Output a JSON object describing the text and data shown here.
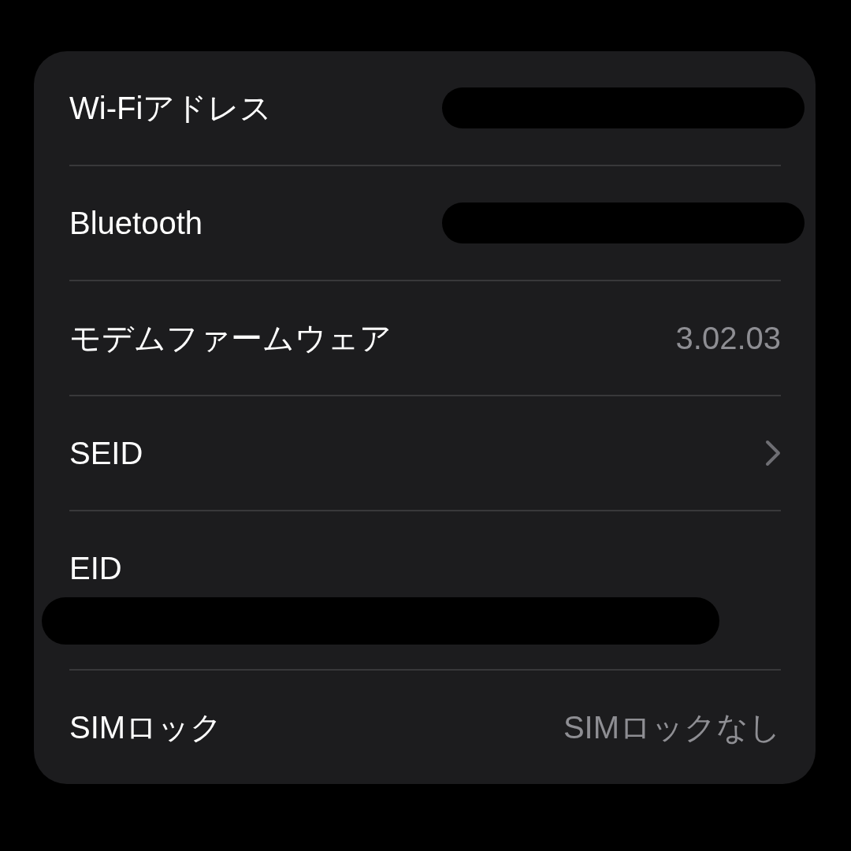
{
  "rows": [
    {
      "label": "Wi-Fiアドレス",
      "kind": "redacted"
    },
    {
      "label": "Bluetooth",
      "kind": "redacted"
    },
    {
      "label": "モデムファームウェア",
      "kind": "value",
      "value": "3.02.03"
    },
    {
      "label": "SEID",
      "kind": "link"
    },
    {
      "label": "EID",
      "kind": "redacted-below"
    },
    {
      "label": "SIMロック",
      "kind": "value",
      "value": "SIMロックなし"
    }
  ]
}
